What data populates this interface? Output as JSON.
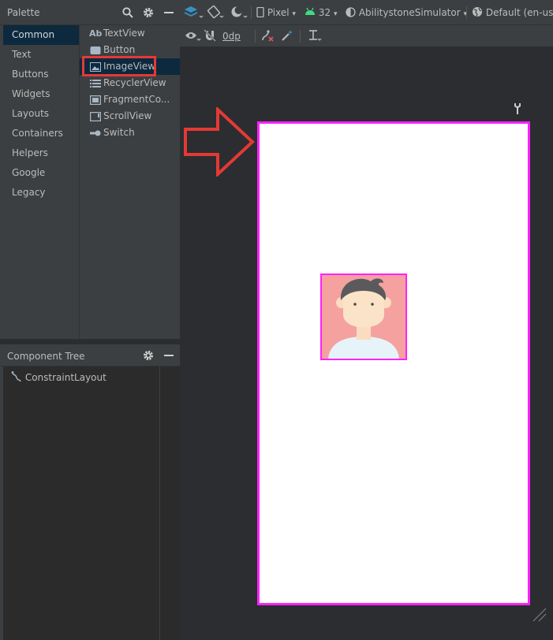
{
  "palette": {
    "title": "Palette",
    "categories": [
      "Common",
      "Text",
      "Buttons",
      "Widgets",
      "Layouts",
      "Containers",
      "Helpers",
      "Google",
      "Legacy"
    ],
    "selected_category": "Common",
    "items": [
      {
        "icon": "Ab",
        "label": "TextView"
      },
      {
        "icon": "button-icon",
        "label": "Button"
      },
      {
        "icon": "image-icon",
        "label": "ImageView"
      },
      {
        "icon": "list-icon",
        "label": "RecyclerView"
      },
      {
        "icon": "fragment-icon",
        "label": "FragmentCo..."
      },
      {
        "icon": "scroll-icon",
        "label": "ScrollView"
      },
      {
        "icon": "switch-icon",
        "label": "Switch"
      }
    ],
    "selected_item": "ImageView"
  },
  "component_tree": {
    "title": "Component Tree",
    "root": "ConstraintLayout"
  },
  "toolbar": {
    "device": "Pixel",
    "api": "32",
    "theme": "AbilitystoneSimulator",
    "locale": "Default (en-us)",
    "margin": "0dp"
  },
  "colors": {
    "selection_outline": "#ff21ff",
    "highlight": "#e53935",
    "image_background": "#f4a19f"
  }
}
